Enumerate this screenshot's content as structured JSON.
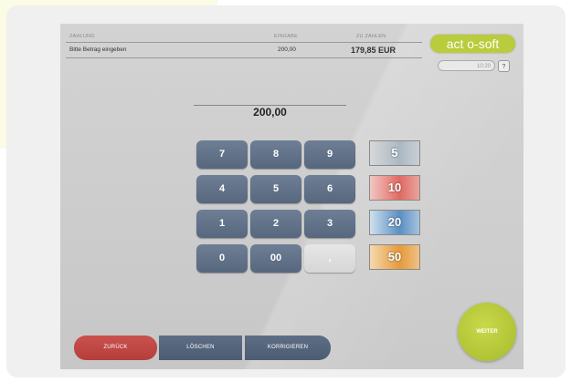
{
  "header": {
    "col_payment": "ZAHLUNG",
    "col_input": "EINGABE",
    "col_due": "ZU ZAHLEN"
  },
  "row": {
    "prompt": "Bitte Betrag eingeben",
    "input_value": "200,00",
    "due_value": "179,85 EUR"
  },
  "logo": "act o-soft",
  "clock": "10:20",
  "help_label": "?",
  "display_value": "200,00",
  "keypad": [
    "7",
    "8",
    "9",
    "4",
    "5",
    "6",
    "1",
    "2",
    "3",
    "0",
    "00",
    ","
  ],
  "notes": [
    "5",
    "10",
    "20",
    "50"
  ],
  "buttons": {
    "back": "ZURÜCK",
    "delete": "LÖSCHEN",
    "correct": "KORRIGIEREN",
    "next": "WEITER"
  },
  "colors": {
    "key": "#5f7088",
    "back": "#c0484a",
    "next": "#b5c73a",
    "logo": "#b9cc3b"
  }
}
